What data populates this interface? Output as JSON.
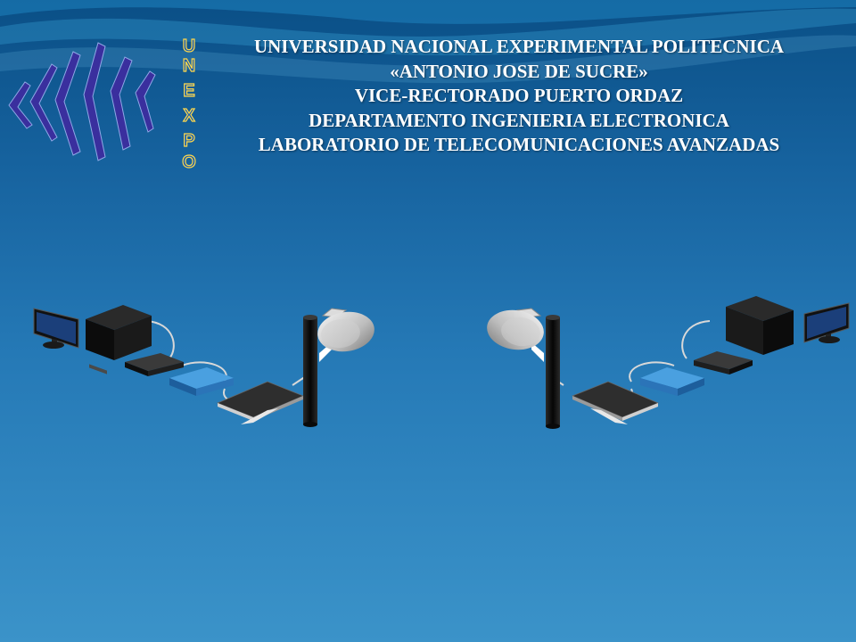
{
  "header": {
    "lines": [
      "UNIVERSIDAD NACIONAL EXPERIMENTAL POLITECNICA",
      "«ANTONIO JOSE DE SUCRE»",
      "VICE-RECTORADO  PUERTO ORDAZ",
      "DEPARTAMENTO  INGENIERIA ELECTRONICA",
      "LABORATORIO DE TELECOMUNICACIONES AVANZADAS"
    ]
  },
  "logo": {
    "letters": [
      "U",
      "N",
      "E",
      "X",
      "P",
      "O"
    ],
    "icon": "unexpo-emblem-icon"
  },
  "scene": {
    "left_station": [
      "monitor-icon",
      "desktop-tower-icon",
      "network-switch-icon",
      "router-icon",
      "antenna-base-icon",
      "antenna-pole-icon",
      "dish-antenna-icon"
    ],
    "right_station": [
      "dish-antenna-icon",
      "antenna-pole-icon",
      "antenna-base-icon",
      "router-icon",
      "network-switch-icon",
      "desktop-tower-icon",
      "monitor-icon"
    ]
  },
  "colors": {
    "background_top": "#0a4f86",
    "background_bottom": "#3b93c9",
    "logo_purple": "#3a2f9e",
    "logo_letter_fill": "#1a5fb0",
    "logo_letter_outline": "#ffd84a",
    "header_text": "#ffffff"
  }
}
